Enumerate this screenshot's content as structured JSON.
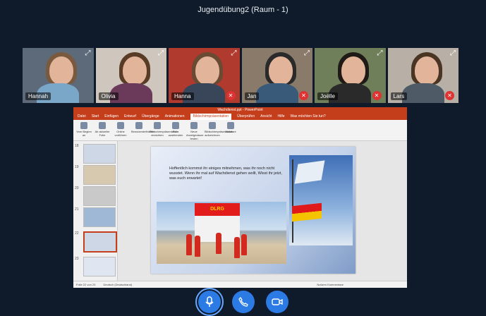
{
  "meeting": {
    "title": "Jugendübung2 (Raum - 1)"
  },
  "participants": [
    {
      "name": "Hannah",
      "muted": false,
      "bg": "#5c6a7a",
      "hair": "#7a5a3e",
      "shirt": "#7aa6c8"
    },
    {
      "name": "Olivia",
      "muted": false,
      "bg": "#cfc6bd",
      "hair": "#5a3b26",
      "shirt": "#6b3a5a"
    },
    {
      "name": "Hanna",
      "muted": true,
      "bg": "#b03a2e",
      "hair": "#6a4a32",
      "shirt": "#39465a"
    },
    {
      "name": "Jan",
      "muted": true,
      "bg": "#8a7a6a",
      "hair": "#2a2a2a",
      "shirt": "#3a5a7a"
    },
    {
      "name": "Joëlle",
      "muted": true,
      "bg": "#6f7f5a",
      "hair": "#1f1a16",
      "shirt": "#2a2a2a"
    },
    {
      "name": "Lars",
      "muted": true,
      "bg": "#b8b0a6",
      "hair": "#4a3524",
      "shirt": "#4e5a66"
    }
  ],
  "ppt": {
    "title": "Wachdienst.ppt - PowerPoint",
    "tabs": [
      "Datei",
      "Start",
      "Einfügen",
      "Entwurf",
      "Übergänge",
      "Animationen",
      "Bildschirmpräsentation",
      "Überprüfen",
      "Ansicht",
      "Hilfe",
      "Was möchten Sie tun?"
    ],
    "active_tab": "Bildschirmpräsentation",
    "ribbon_groups": [
      "Vom Beginn an",
      "Ab aktueller Folie",
      "Online vorführen",
      "Benutzerdefinierte",
      "Bildschirmpräsentation einrichten",
      "Folie ausblenden",
      "Neue Anzeigedauer testen",
      "Bildschirmpräsentation aufzeichnen",
      "Monitore"
    ],
    "thumb_numbers": [
      "18",
      "19",
      "20",
      "21",
      "22",
      "23"
    ],
    "slide_text": "Hoffentlich kommst ihr einiges mitnehmen, was ihr noch nicht wusstet. Wenn ihr mal auf Wachdienst gehen wollt, Wisst ihr jetzt, was euch erwartet!",
    "dlrg_sign": "DLRG",
    "status_left": "Folie 22 von 23",
    "status_lang": "Deutsch (Deutschland)",
    "status_right": "Notizen   Kommentare"
  },
  "controls": [
    "mic-button",
    "phone-button",
    "camera-button"
  ]
}
